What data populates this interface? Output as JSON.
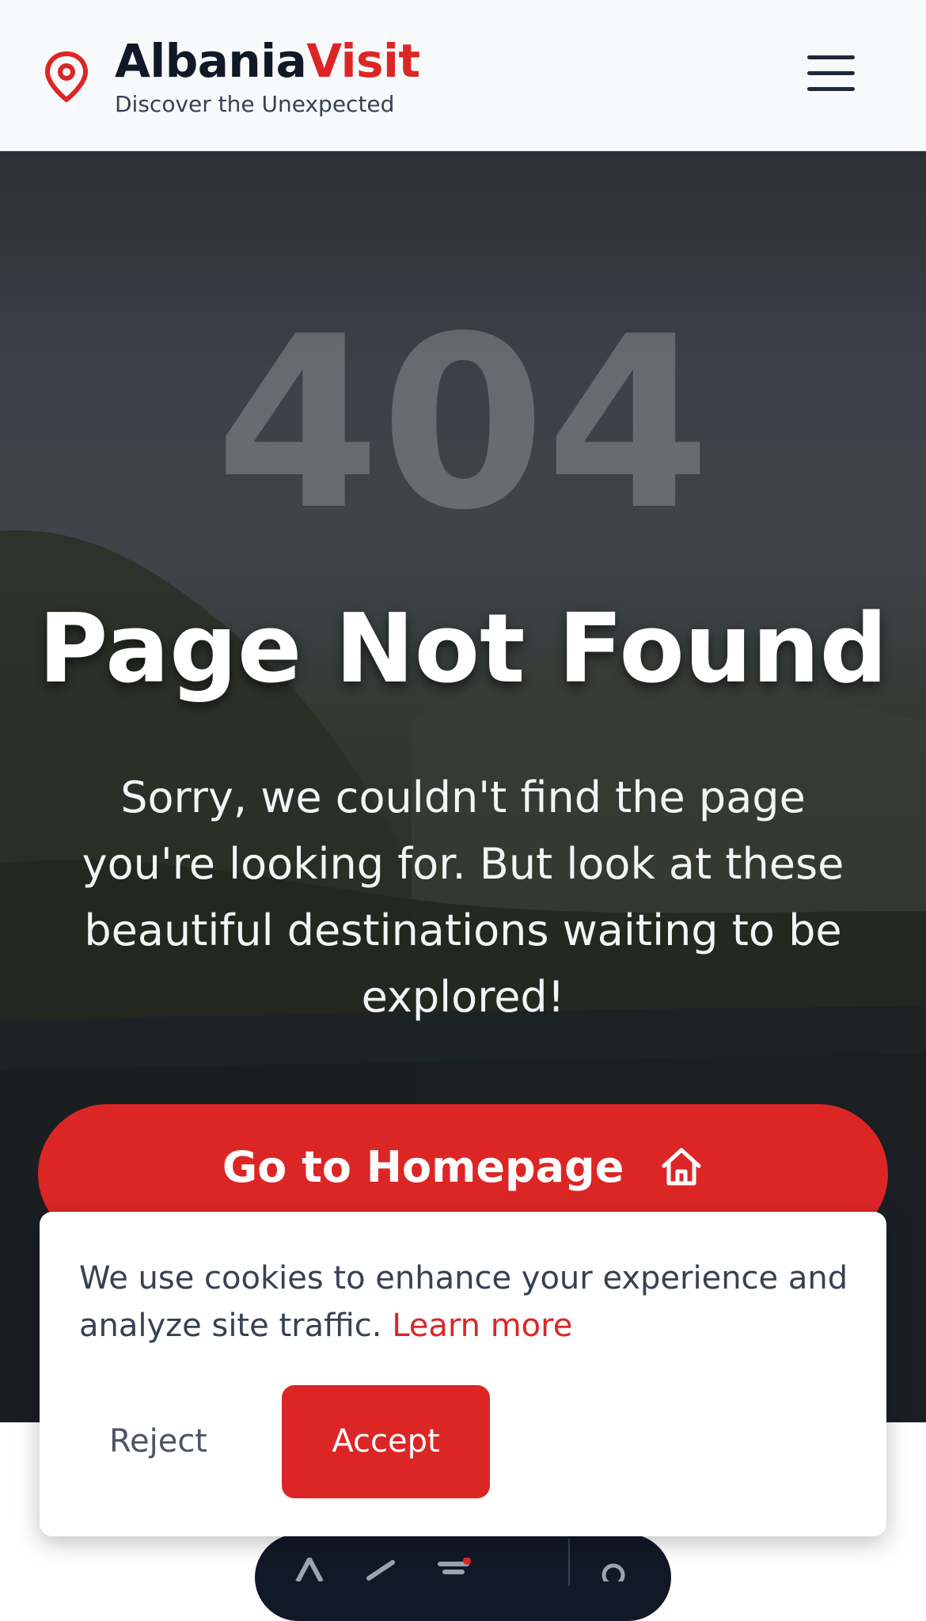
{
  "header": {
    "brand_main": "Albania",
    "brand_accent": "Visit",
    "tagline": "Discover the Unexpected",
    "logo_icon": "map-pin-icon",
    "menu_icon": "hamburger-menu-icon"
  },
  "hero": {
    "code": "404",
    "title": "Page Not Found",
    "description": "Sorry, we couldn't find the page you're looking for. But look at these beautiful destinations waiting to be explored!",
    "home_button_label": "Go to Homepage",
    "home_button_icon": "home-icon"
  },
  "cookie_banner": {
    "text": "We use cookies to enhance your experience and analyze site traffic.",
    "link_label": "Learn more",
    "reject_label": "Reject",
    "accept_label": "Accept"
  },
  "colors": {
    "accent": "#dc2626",
    "text_dark": "#111827"
  }
}
